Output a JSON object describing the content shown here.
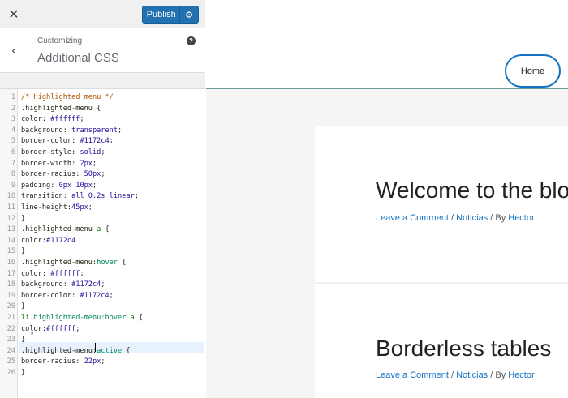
{
  "topbar": {
    "close_glyph": "✕",
    "publish_label": "Publish",
    "settings_glyph": "⚙"
  },
  "section": {
    "back_glyph": "‹",
    "breadcrumb": "Customizing",
    "title": "Additional CSS",
    "help_glyph": "?"
  },
  "editor": {
    "marker_glyph": "ª",
    "lines": [
      [
        [
          "/* Highlighted menu */",
          "com"
        ]
      ],
      [
        [
          ".highlighted-menu {",
          "sel"
        ]
      ],
      [
        [
          "color: ",
          "prop"
        ],
        [
          "#ffffff",
          "val"
        ],
        [
          ";",
          "prop"
        ]
      ],
      [
        [
          "background: ",
          "prop"
        ],
        [
          "transparent",
          "val"
        ],
        [
          ";",
          "prop"
        ]
      ],
      [
        [
          "border-color: ",
          "prop"
        ],
        [
          "#1172c4",
          "val"
        ],
        [
          ";",
          "prop"
        ]
      ],
      [
        [
          "border-style: ",
          "prop"
        ],
        [
          "solid",
          "val"
        ],
        [
          ";",
          "prop"
        ]
      ],
      [
        [
          "border-width: ",
          "prop"
        ],
        [
          "2px",
          "val"
        ],
        [
          ";",
          "prop"
        ]
      ],
      [
        [
          "border-radius: ",
          "prop"
        ],
        [
          "50px",
          "val"
        ],
        [
          ";",
          "prop"
        ]
      ],
      [
        [
          "padding: ",
          "prop"
        ],
        [
          "0px 10px",
          "val"
        ],
        [
          ";",
          "prop"
        ]
      ],
      [
        [
          "transition: ",
          "prop"
        ],
        [
          "all 0.2s linear",
          "val"
        ],
        [
          ";",
          "prop"
        ]
      ],
      [
        [
          "line-height:",
          "prop"
        ],
        [
          "45px",
          "val"
        ],
        [
          ";",
          "prop"
        ]
      ],
      [
        [
          "}",
          "prop"
        ]
      ],
      [
        [
          ".highlighted-menu ",
          "sel"
        ],
        [
          "a",
          "tag"
        ],
        [
          " {",
          "sel"
        ]
      ],
      [
        [
          "color:",
          "prop"
        ],
        [
          "#1172c4",
          "val"
        ]
      ],
      [
        [
          "}",
          "prop"
        ]
      ],
      [
        [
          ".highlighted-menu:",
          "sel"
        ],
        [
          "hover",
          "kw"
        ],
        [
          " {",
          "sel"
        ]
      ],
      [
        [
          "color: ",
          "prop"
        ],
        [
          "#ffffff",
          "val"
        ],
        [
          ";",
          "prop"
        ]
      ],
      [
        [
          "background: ",
          "prop"
        ],
        [
          "#1172c4",
          "val"
        ],
        [
          ";",
          "prop"
        ]
      ],
      [
        [
          "border-color: ",
          "prop"
        ],
        [
          "#1172c4",
          "val"
        ],
        [
          ";",
          "prop"
        ]
      ],
      [
        [
          "}",
          "prop"
        ]
      ],
      [
        [
          "li",
          "tag"
        ],
        [
          ".highlighted-menu:hover ",
          "kw"
        ],
        [
          "a",
          "tag"
        ],
        [
          " {",
          "sel"
        ]
      ],
      [
        [
          "color:",
          "prop"
        ],
        [
          "#ffffff",
          "val"
        ],
        [
          ";",
          "prop"
        ]
      ],
      [
        [
          "}",
          "prop"
        ]
      ],
      [
        [
          ".highlighted-menu:",
          "sel"
        ],
        [
          "active",
          "kw"
        ],
        [
          " {",
          "sel"
        ]
      ],
      [
        [
          "border-radius: ",
          "prop"
        ],
        [
          "22px",
          "val"
        ],
        [
          ";",
          "prop"
        ]
      ],
      [
        [
          "}",
          "prop"
        ]
      ]
    ]
  },
  "preview": {
    "nav_home": "Home",
    "posts": [
      {
        "title": "Welcome to the blog",
        "comment": "Leave a Comment",
        "sep": " / ",
        "category": "Noticias",
        "by": " / By ",
        "author": "Hector"
      },
      {
        "title": "Borderless tables",
        "comment": "Leave a Comment",
        "sep": " / ",
        "category": "Noticias",
        "by": " / By ",
        "author": "Hector"
      }
    ]
  },
  "colors": {
    "publish": "#2271b1",
    "link": "#1172c4",
    "active_line": "#e8f2ff"
  }
}
